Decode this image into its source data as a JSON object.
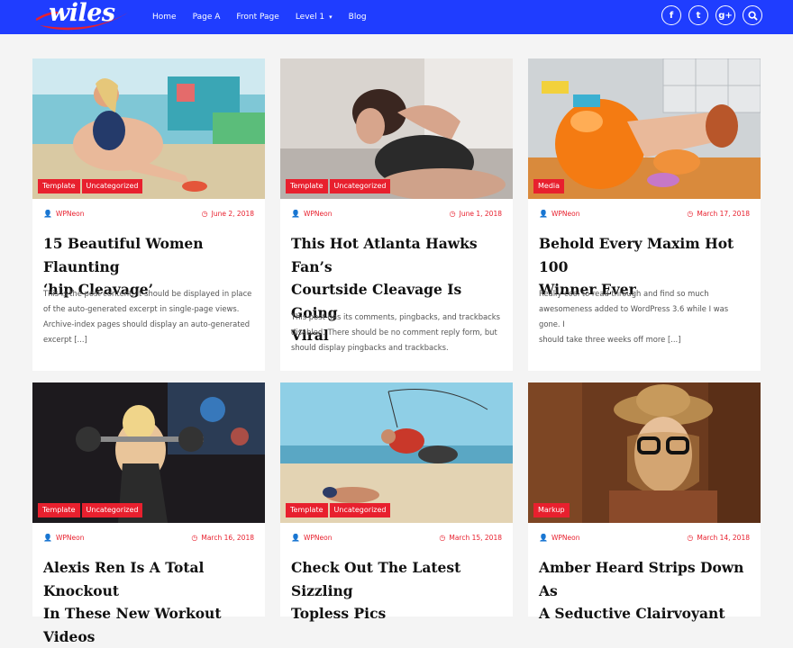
{
  "header": {
    "logo_text": "wiles",
    "nav": [
      {
        "label": "Home"
      },
      {
        "label": "Page A"
      },
      {
        "label": "Front Page"
      },
      {
        "label": "Level 1"
      },
      {
        "label": "Blog"
      }
    ],
    "level1_caret": "▾",
    "social": [
      {
        "icon": "facebook-icon",
        "glyph": "f"
      },
      {
        "icon": "twitter-icon",
        "glyph": "t"
      },
      {
        "icon": "google-plus-icon",
        "glyph": "g+"
      },
      {
        "icon": "search-icon",
        "glyph": "⚲"
      }
    ]
  },
  "colors": {
    "header": "#1f3dff",
    "accent": "#e8202e",
    "bg": "#f4f4f4"
  },
  "posts": [
    {
      "tags": [
        "Template",
        "Uncategorized"
      ],
      "author": "WPNeon",
      "date": "June 2, 2018",
      "title_lines": [
        "15 Beautiful Women Flaunting",
        "‘hip Cleavage’"
      ],
      "excerpt_lines": [
        "This is the post content. It should be displayed in place",
        "of the auto-generated excerpt in single-page views.",
        "Archive-index pages should display an auto-generated",
        "excerpt [...]"
      ]
    },
    {
      "tags": [
        "Template",
        "Uncategorized"
      ],
      "author": "WPNeon",
      "date": "June 1, 2018",
      "title_lines": [
        "This Hot Atlanta Hawks Fan’s",
        "Courtside Cleavage Is Going",
        "Viral"
      ],
      "excerpt_lines": [
        "This post has its comments, pingbacks, and trackbacks",
        "disabled. There should be no comment reply form, but",
        "should display pingbacks and trackbacks."
      ]
    },
    {
      "tags": [
        "Media"
      ],
      "author": "WPNeon",
      "date": "March 17, 2018",
      "title_lines": [
        "Behold Every Maxim Hot 100",
        "Winner Ever"
      ],
      "excerpt_lines": [
        "Really cool to read through and find so much",
        "awesomeness added to WordPress 3.6 while I was gone. I",
        "should take three weeks off more [...]"
      ]
    },
    {
      "tags": [
        "Template",
        "Uncategorized"
      ],
      "author": "WPNeon",
      "date": "March 16, 2018",
      "title_lines": [
        "Alexis Ren Is A Total Knockout",
        "In These New Workout Videos"
      ],
      "excerpt_lines": []
    },
    {
      "tags": [
        "Template",
        "Uncategorized"
      ],
      "author": "WPNeon",
      "date": "March 15, 2018",
      "title_lines": [
        "Check Out The Latest Sizzling",
        "Topless Pics"
      ],
      "excerpt_lines": []
    },
    {
      "tags": [
        "Markup"
      ],
      "author": "WPNeon",
      "date": "March 14, 2018",
      "title_lines": [
        "Amber Heard Strips Down As",
        "A Seductive Clairvoyant"
      ],
      "excerpt_lines": []
    }
  ]
}
